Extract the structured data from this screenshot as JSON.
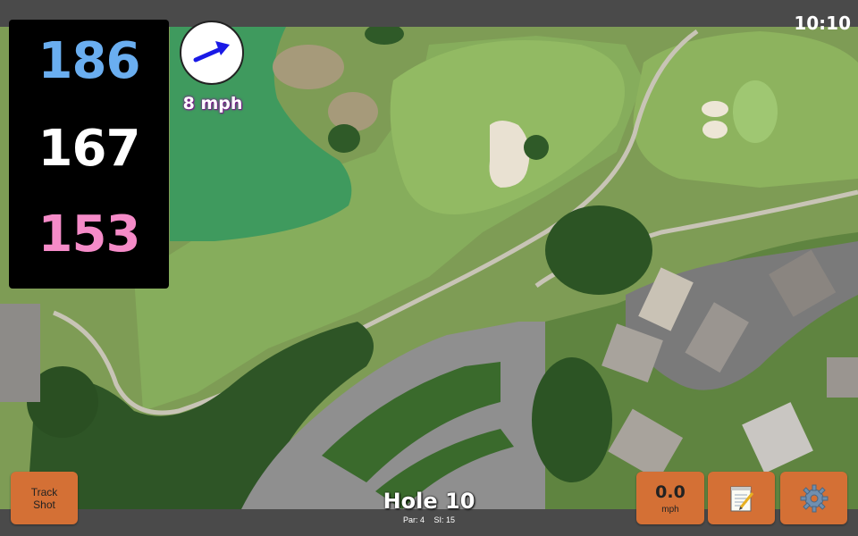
{
  "status_bar": {
    "clock": "10:10"
  },
  "distances": {
    "back": "186",
    "middle": "167",
    "front": "153",
    "colors": {
      "back": "#6aaef0",
      "middle": "#ffffff",
      "front": "#f58bc8"
    }
  },
  "wind": {
    "speed_label": "8 mph",
    "arrow_icon": "arrow-right-icon",
    "arrow_color": "#1a1ae6"
  },
  "buttons": {
    "track_shot": {
      "line1": "Track",
      "line2": "Shot"
    },
    "speed": {
      "value": "0.0",
      "unit": "mph"
    },
    "notes_icon": "notepad-icon",
    "settings_icon": "gear-icon",
    "color": "#d47035"
  },
  "hole": {
    "title": "Hole 10",
    "par_label": "Par: 4",
    "si_label": "SI: 15"
  }
}
